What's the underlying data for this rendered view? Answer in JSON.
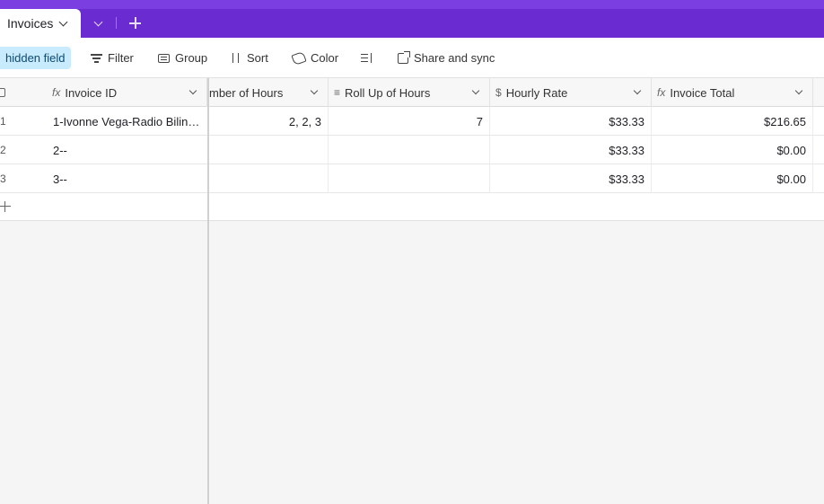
{
  "tabs": {
    "active_label": "Invoices"
  },
  "toolbar": {
    "hidden_fields_label": "hidden field",
    "filter_label": "Filter",
    "group_label": "Group",
    "sort_label": "Sort",
    "color_label": "Color",
    "share_label": "Share and sync"
  },
  "columns": {
    "invoice_id": "Invoice ID",
    "number_of_hours": "mber of Hours",
    "roll_up_of_hours": "Roll Up of Hours",
    "hourly_rate": "Hourly Rate",
    "invoice_total": "Invoice Total"
  },
  "rows": [
    {
      "num": "1",
      "invoice_id": "1-Ivonne Vega-Radio Bilin…",
      "number_of_hours": "2, 2, 3",
      "roll_up_of_hours": "7",
      "hourly_rate": "$33.33",
      "invoice_total": "$216.65"
    },
    {
      "num": "2",
      "invoice_id": "2--",
      "number_of_hours": "",
      "roll_up_of_hours": "",
      "hourly_rate": "$33.33",
      "invoice_total": "$0.00"
    },
    {
      "num": "3",
      "invoice_id": "3--",
      "number_of_hours": "",
      "roll_up_of_hours": "",
      "hourly_rate": "$33.33",
      "invoice_total": "$0.00"
    }
  ],
  "icons": {
    "formula": "fx-icon",
    "lookup": "lookup-icon",
    "currency": "currency-icon"
  },
  "colors": {
    "brand": "#6a2bd1",
    "hidden_pill": "#c9ebff"
  }
}
